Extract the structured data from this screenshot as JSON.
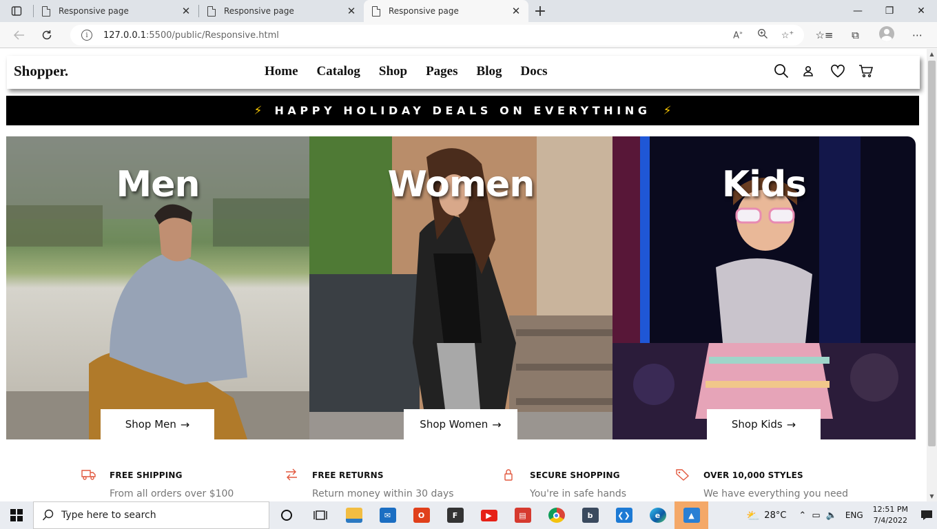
{
  "browser": {
    "tabs": [
      {
        "title": "Responsive page",
        "active": false
      },
      {
        "title": "Responsive page",
        "active": false
      },
      {
        "title": "Responsive page",
        "active": true
      }
    ],
    "url_host": "127.0.0.1",
    "url_path": ":5500/public/Responsive.html"
  },
  "site": {
    "logo": "Shopper.",
    "nav": [
      "Home",
      "Catalog",
      "Shop",
      "Pages",
      "Blog",
      "Docs"
    ],
    "promo": "HAPPY HOLIDAY DEALS ON EVERYTHING",
    "promo_icon": "⚡",
    "cards": [
      {
        "title": "Men",
        "button": "Shop Men",
        "arrow": "→"
      },
      {
        "title": "Women",
        "button": "Shop Women",
        "arrow": "→"
      },
      {
        "title": "Kids",
        "button": "Shop Kids",
        "arrow": "→"
      }
    ],
    "features": [
      {
        "title": "FREE SHIPPING",
        "desc": "From all orders over $100",
        "icon": "truck-icon"
      },
      {
        "title": "FREE RETURNS",
        "desc": "Return money within 30 days",
        "icon": "exchange-icon"
      },
      {
        "title": "SECURE SHOPPING",
        "desc": "You're in safe hands",
        "icon": "lock-icon"
      },
      {
        "title": "OVER 10,000 STYLES",
        "desc": "We have everything you need",
        "icon": "tag-icon"
      }
    ],
    "accent_color": "#e2583e"
  },
  "taskbar": {
    "search_placeholder": "Type here to search",
    "weather": "28°C",
    "lang": "ENG",
    "time": "12:51 PM",
    "date": "7/4/2022"
  }
}
